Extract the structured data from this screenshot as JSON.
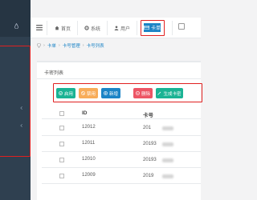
{
  "navbar": {
    "tabs": [
      {
        "label": "首页",
        "icon": "home-icon"
      },
      {
        "label": "系统",
        "icon": "gear-icon"
      },
      {
        "label": "用户",
        "icon": "user-icon"
      }
    ],
    "active_tab": {
      "label": "卡单",
      "icon": "card-icon"
    }
  },
  "breadcrumb": {
    "items": [
      "卡单",
      "卡号管理",
      "卡号列表"
    ]
  },
  "panel": {
    "title": "卡密列表"
  },
  "toolbar": {
    "buttons": [
      {
        "label": "启用",
        "icon": "check-icon",
        "color": "#1ab394"
      },
      {
        "label": "禁用",
        "icon": "ban-icon",
        "color": "#f8ac59"
      },
      {
        "label": "新增",
        "icon": "plus-icon",
        "color": "#1c84c6"
      },
      {
        "label": "删除",
        "icon": "trash-icon",
        "color": "#ed5565"
      },
      {
        "label": "生成卡密",
        "icon": "magic-icon",
        "color": "#1ab394"
      }
    ]
  },
  "table": {
    "columns": [
      "ID",
      "卡号"
    ],
    "rows": [
      {
        "id": "12012",
        "card": "201"
      },
      {
        "id": "12011",
        "card": "20193"
      },
      {
        "id": "12010",
        "card": "20193"
      },
      {
        "id": "12009",
        "card": "2019"
      }
    ]
  },
  "colors": {
    "sidebar": "#2f4050",
    "primary": "#1c84c6",
    "highlight": "#e02020"
  }
}
